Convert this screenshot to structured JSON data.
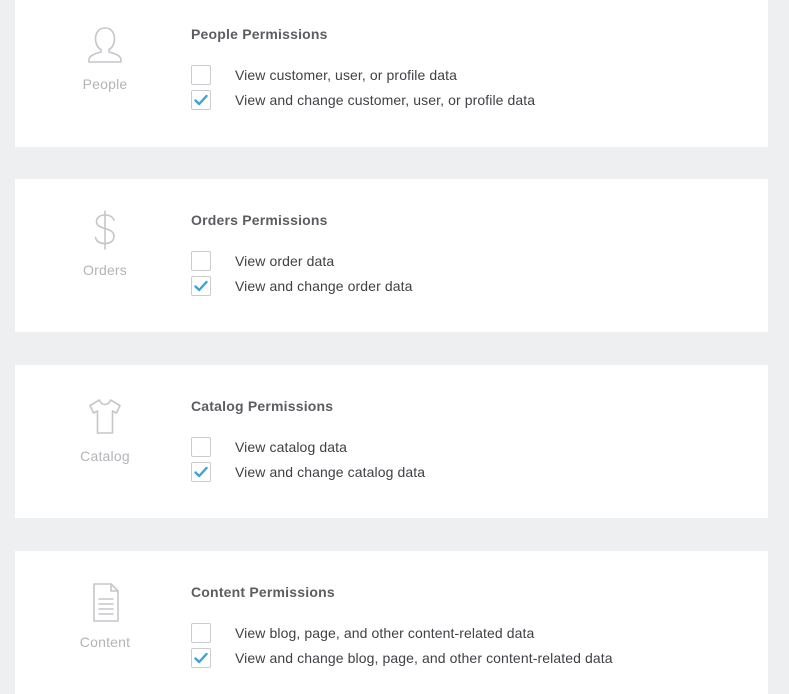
{
  "theme": {
    "check_color": "#3ba3d8",
    "icon_color": "#c4c6ca"
  },
  "sections": [
    {
      "icon": "person-icon",
      "icon_label": "People",
      "title": "People Permissions",
      "permissions": [
        {
          "label": "View customer, user, or profile data",
          "checked": false
        },
        {
          "label": "View and change customer, user, or profile data",
          "checked": true
        }
      ]
    },
    {
      "icon": "dollar-icon",
      "icon_label": "Orders",
      "title": "Orders Permissions",
      "permissions": [
        {
          "label": "View order data",
          "checked": false
        },
        {
          "label": "View and change order data",
          "checked": true
        }
      ]
    },
    {
      "icon": "tshirt-icon",
      "icon_label": "Catalog",
      "title": "Catalog Permissions",
      "permissions": [
        {
          "label": "View catalog data",
          "checked": false
        },
        {
          "label": "View and change catalog data",
          "checked": true
        }
      ]
    },
    {
      "icon": "document-icon",
      "icon_label": "Content",
      "title": "Content Permissions",
      "permissions": [
        {
          "label": "View blog, page, and other content-related data",
          "checked": false
        },
        {
          "label": "View and change blog, page, and other content-related data",
          "checked": true
        }
      ]
    }
  ]
}
